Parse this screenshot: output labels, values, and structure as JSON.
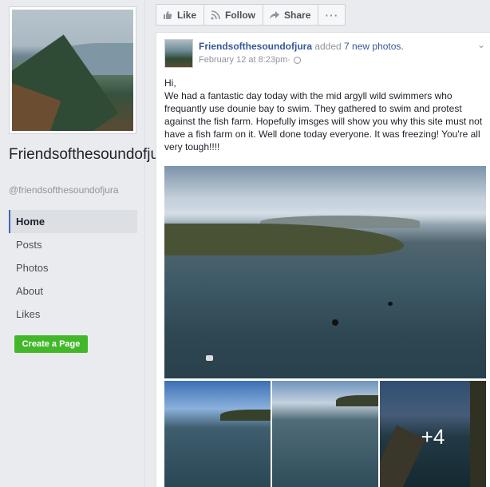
{
  "sidebar": {
    "page_name": "Friendsofthesoundofjura",
    "page_handle": "@friendsofthesoundofjura",
    "nav": [
      {
        "label": "Home",
        "active": true
      },
      {
        "label": "Posts"
      },
      {
        "label": "Photos"
      },
      {
        "label": "About"
      },
      {
        "label": "Likes"
      }
    ],
    "create_page_label": "Create a Page"
  },
  "actions": {
    "like_label": "Like",
    "follow_label": "Follow",
    "share_label": "Share",
    "more_label": "···"
  },
  "post": {
    "author": "Friendsofthesoundofjura",
    "action_text": " added ",
    "action_link": "7 new photos.",
    "timestamp": "February 12 at 8:23pm",
    "separator": " · ",
    "text_greeting": "Hi,",
    "text_body": "We had a fantastic day today with the mid argyll wild swimmers who frequantly use dounie bay to swim. They gathered to swim and protest against the fish farm. Hopefully imsges will show you why this site must not have a fish farm on it. Well done today everyone. It was freezing! You're all very tough!!!!",
    "more_photos_label": "+4"
  },
  "colors": {
    "link": "#365899",
    "create_button": "#42b72a",
    "background": "#e9ebee"
  }
}
